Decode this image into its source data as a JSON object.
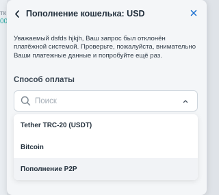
{
  "backdrop": {
    "fragment_1": "тк",
    "fragment_2": "00"
  },
  "modal": {
    "back_icon": "chevron-left-icon",
    "title": "Пополнение кошелька: USD",
    "close_icon": "close-icon",
    "message": "Уважаемый dsfds hjkjh, Ваш запрос был отклонён платёжной системой. Проверьте, пожалуйста, внимательно Ваши платежные данные и попробуйте ещё раз.",
    "payment_method_label": "Способ оплаты",
    "search": {
      "placeholder": "Поиск",
      "value": "",
      "icon": "search-icon",
      "chevron_icon": "chevron-up-icon"
    },
    "options": [
      {
        "label": "Tether TRC-20 (USDT)"
      },
      {
        "label": "Bitcoin"
      },
      {
        "label": "Пополнение P2P"
      }
    ]
  },
  "colors": {
    "accent": "#1a6fd0",
    "modal_bg": "#f4f6f8",
    "backdrop": "#dfe3e8"
  }
}
